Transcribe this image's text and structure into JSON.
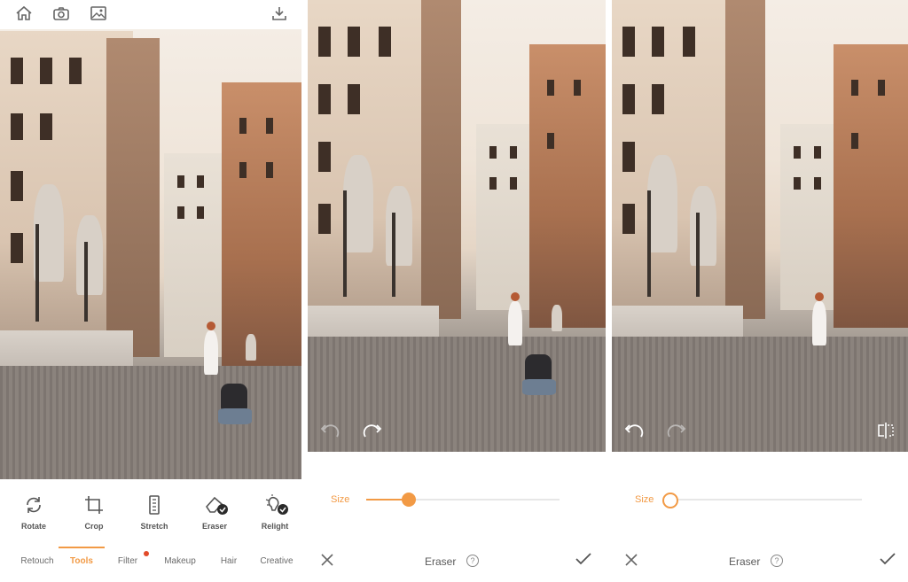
{
  "panel1": {
    "tools": [
      {
        "label": "Rotate",
        "icon": "rotate-icon"
      },
      {
        "label": "Crop",
        "icon": "crop-icon"
      },
      {
        "label": "Stretch",
        "icon": "stretch-icon"
      },
      {
        "label": "Eraser",
        "icon": "eraser-icon"
      },
      {
        "label": "Relight",
        "icon": "relight-icon"
      }
    ],
    "nav": [
      {
        "label": "Retouch"
      },
      {
        "label": "Tools"
      },
      {
        "label": "Filter"
      },
      {
        "label": "Makeup"
      },
      {
        "label": "Hair"
      },
      {
        "label": "Creative"
      }
    ],
    "active_nav": "Tools"
  },
  "panel2": {
    "size_label": "Size",
    "slider_value": 0.22,
    "title": "Eraser",
    "help": "?"
  },
  "panel3": {
    "size_label": "Size",
    "slider_value": 0.0,
    "title": "Eraser",
    "help": "?"
  },
  "colors": {
    "accent": "#f29a45",
    "badge_dot": "#e24b2a"
  }
}
